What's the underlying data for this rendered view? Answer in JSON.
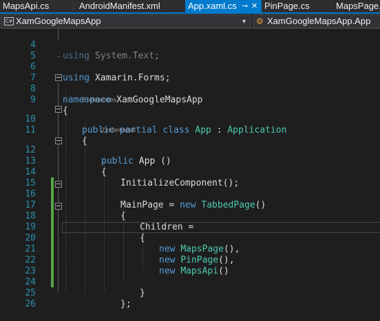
{
  "tabs": [
    {
      "label": "MapsApi.cs",
      "active": false
    },
    {
      "label": "AndroidManifest.xml",
      "active": false
    },
    {
      "label": "App.xaml.cs",
      "active": true
    },
    {
      "label": "PinPage.cs",
      "active": false
    },
    {
      "label": "MapsPage.cs",
      "active": false
    }
  ],
  "tab_icons": {
    "pin": "pin-icon",
    "close": "close-icon"
  },
  "navbar": {
    "project_badge": "C#",
    "project": "XamGoogleMapsApp",
    "type": "XamGoogleMapsApp.App"
  },
  "colors": {
    "accent": "#007acc",
    "background": "#1e1e1e",
    "keyword": "#569cd6",
    "type": "#4ec9b0",
    "line_number": "#2b91af",
    "change_bar": "#57a64a"
  },
  "code": {
    "line_numbers": [
      "4",
      "5",
      "6",
      "7",
      "8",
      "9",
      "10",
      "11",
      "12",
      "13",
      "14",
      "15",
      "16",
      "17",
      "18",
      "19",
      "20",
      "21",
      "22",
      "23",
      "24",
      "25",
      "26"
    ],
    "l4": {
      "kw": "using",
      "rest": " System.Text;"
    },
    "l6": {
      "kw": "using",
      "rest": " Xamarin.Forms;"
    },
    "l8": {
      "kw": "namespace",
      "rest": " XamGoogleMapsApp"
    },
    "l9": "{",
    "lens10": "5 references",
    "l10": {
      "kw1": "public",
      "kw2": "partial",
      "kw3": "class",
      "name": "App",
      "colon": " : ",
      "base": "Application"
    },
    "l11": "{",
    "lens12": "2 references",
    "l12": {
      "kw": "public",
      "rest": " App ()"
    },
    "l13": "{",
    "l14": "InitializeComponent();",
    "l16": {
      "pre": "MainPage = ",
      "kw": "new",
      "ty": "TabbedPage",
      "post": "()"
    },
    "l17": "{",
    "l18": "Children =",
    "l19": "{",
    "l20": {
      "kw": "new",
      "ty": "MapsPage",
      "post": "(),"
    },
    "l21": {
      "kw": "new",
      "ty": "PinPage",
      "post": "(),"
    },
    "l22": {
      "kw": "new",
      "ty": "MapsApi",
      "post": "()"
    },
    "l24": "}",
    "l25": "};"
  }
}
